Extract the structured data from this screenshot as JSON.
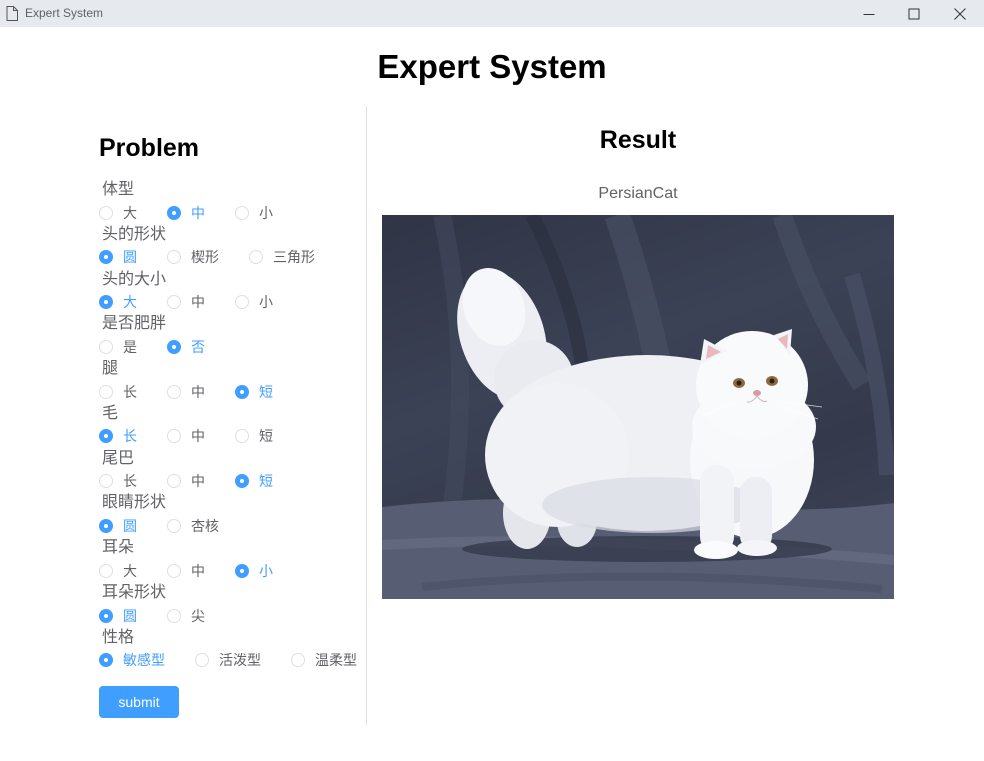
{
  "window": {
    "title": "Expert System",
    "icons": {
      "app": "document-icon",
      "minimize": "minimize-icon",
      "maximize": "maximize-icon",
      "close": "close-icon"
    }
  },
  "page": {
    "title": "Expert System"
  },
  "problem": {
    "heading": "Problem",
    "questions": [
      {
        "label": "体型",
        "options": [
          "大",
          "中",
          "小"
        ],
        "selected": "中"
      },
      {
        "label": "头的形状",
        "options": [
          "圆",
          "楔形",
          "三角形"
        ],
        "selected": "圆"
      },
      {
        "label": "头的大小",
        "options": [
          "大",
          "中",
          "小"
        ],
        "selected": "大"
      },
      {
        "label": "是否肥胖",
        "options": [
          "是",
          "否"
        ],
        "selected": "否"
      },
      {
        "label": "腿",
        "options": [
          "长",
          "中",
          "短"
        ],
        "selected": "短"
      },
      {
        "label": "毛",
        "options": [
          "长",
          "中",
          "短"
        ],
        "selected": "长"
      },
      {
        "label": "尾巴",
        "options": [
          "长",
          "中",
          "短"
        ],
        "selected": "短"
      },
      {
        "label": "眼睛形状",
        "options": [
          "圆",
          "杏核"
        ],
        "selected": "圆"
      },
      {
        "label": "耳朵",
        "options": [
          "大",
          "中",
          "小"
        ],
        "selected": "小"
      },
      {
        "label": "耳朵形状",
        "options": [
          "圆",
          "尖"
        ],
        "selected": "圆"
      },
      {
        "label": "性格",
        "options": [
          "敏感型",
          "活泼型",
          "温柔型"
        ],
        "selected": "敏感型"
      }
    ],
    "submit_label": "submit"
  },
  "result": {
    "heading": "Result",
    "name": "PersianCat"
  },
  "colors": {
    "accent": "#409eff",
    "text": "#606266",
    "divider": "#dcdfe6",
    "heading": "#000000"
  }
}
